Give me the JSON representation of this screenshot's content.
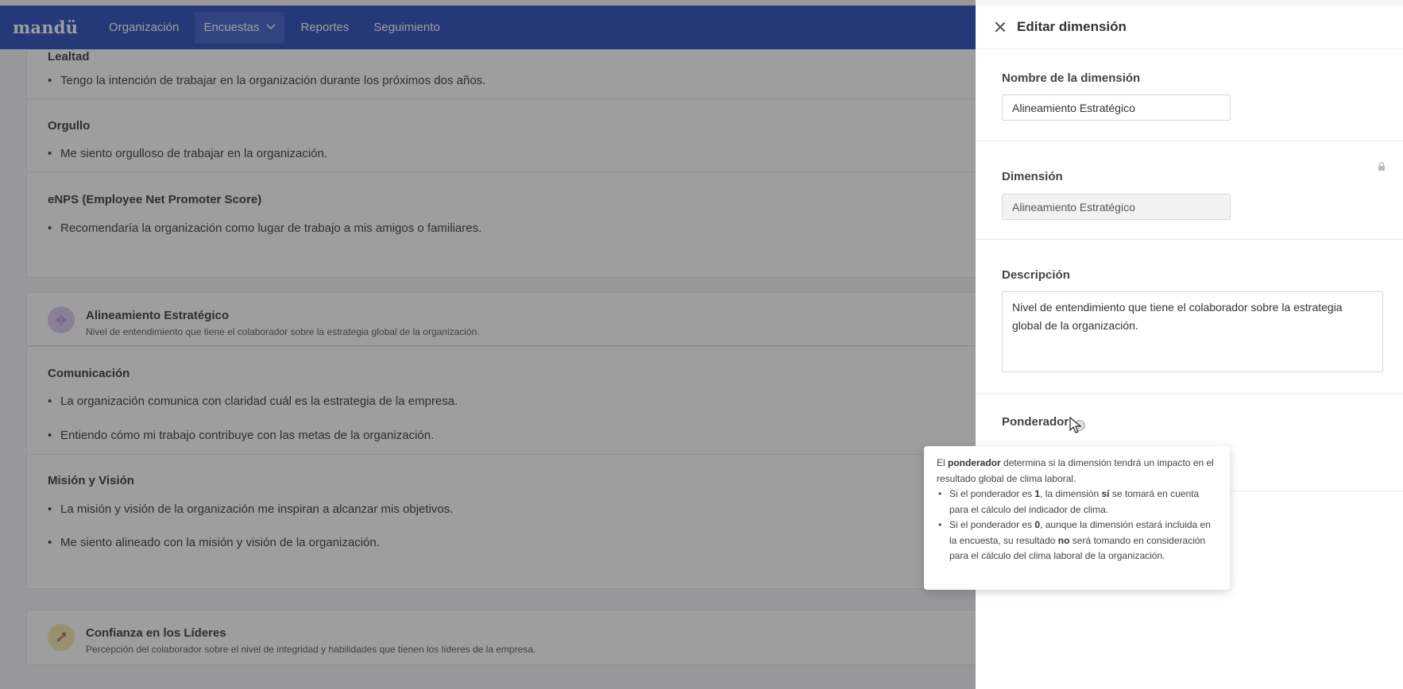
{
  "nav": {
    "brand": "mandü",
    "items": [
      "Organización",
      "Encuestas",
      "Reportes",
      "Seguimiento"
    ],
    "active": "Encuestas"
  },
  "background": {
    "group1": {
      "sections": [
        {
          "title": "Lealtad",
          "items": [
            "Tengo la intención de trabajar en la organización durante los próximos dos años."
          ]
        },
        {
          "title": "Orgullo",
          "items": [
            "Me siento orgulloso de trabajar en la organización."
          ]
        },
        {
          "title": "eNPS (Employee Net Promoter Score)",
          "items": [
            "Recomendaría la organización como lugar de trabajo a mis amigos o familiares."
          ]
        }
      ]
    },
    "dimension1": {
      "name": "Alineamiento Estratégico",
      "description": "Nivel de entendimiento que tiene el colaborador sobre la estrategia global de la organización.",
      "icon": "compass-icon",
      "icon_color": "#d8c8f2"
    },
    "group2": {
      "sections": [
        {
          "title": "Comunicación",
          "items": [
            "La organización comunica con claridad cuál es la estrategia de la empresa.",
            "Entiendo cómo mi trabajo contribuye con las metas de la organización."
          ]
        },
        {
          "title": "Misión y Visión",
          "items": [
            "La misión y visión de la organización me inspiran a alcanzar mis objetivos.",
            "Me siento alineado con la misión y visión de la organización."
          ]
        }
      ]
    },
    "dimension2": {
      "name": "Confianza en los Líderes",
      "description": "Percepción del colaborador sobre el nivel de integridad y habilidades que tienen los líderes de la empresa.",
      "icon": "rocket-icon",
      "icon_color": "#f6e6a8"
    }
  },
  "drawer": {
    "title": "Editar dimensión",
    "fields": {
      "name_label": "Nombre de la dimensión",
      "name_value": "Alineamiento Estratégico",
      "dimension_label": "Dimensión",
      "dimension_value": "Alineamiento Estratégico",
      "description_label": "Descripción",
      "description_value": "Nivel de entendimiento que tiene el colaborador sobre la estrategia global de la organización.",
      "ponderador_label": "Ponderador"
    }
  },
  "tooltip": {
    "intro_pre": "El ",
    "intro_bold": "ponderador",
    "intro_post": " determina si la dimensión tendrá un impacto en el resultado global de clima laboral.",
    "b1_pre": "Si el ponderador es ",
    "b1_value": "1",
    "b1_mid": ", la dimensión ",
    "b1_bold": "sí",
    "b1_post": " se tomará en cuenta para el cálculo del indicador de clima.",
    "b2_pre": "Si el ponderador es ",
    "b2_value": "0",
    "b2_mid": ", aunque la dimensión estará incluida en la encuesta, su resultado ",
    "b2_bold": "no",
    "b2_post": " será tomando en consideración para el cálculo del clima laboral de la organización."
  }
}
